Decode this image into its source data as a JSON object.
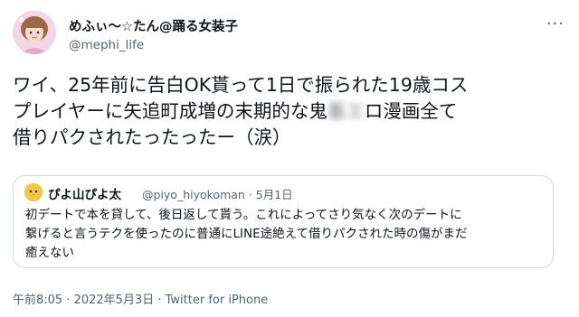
{
  "author": {
    "display_name": "めふぃ〜☆たん@踊る女装子",
    "handle": "@mephi_life"
  },
  "tweet": {
    "text_line1": "ワイ、25年前に告白OK貰って1日で振られた19歳コス",
    "text_line2": "プレイヤーに矢追町成増の末期的な鬼畜エロ漫画全て",
    "text_line3": "借りパクされたったったー（涙）",
    "blurred_segment": "畜エ"
  },
  "quote": {
    "name": "ぴよ山ぴよ太",
    "meta": "@piyo_hiyokoman · 5月1日",
    "text": "初デートで本を貸して、後日返して貰う。これによってさり気なく次のデートに\n繋げると言うテクを使ったのに普通にLINE途絶えて借りパクされた時の傷がまだ\n癒えない"
  },
  "footer": {
    "timestamp": "午前8:05 · 2022年5月3日",
    "source": "Twitter for iPhone"
  },
  "colors": {
    "text": "#0f1419",
    "secondary": "#536471",
    "border": "#cfd9de",
    "quote_avatar": "#f2c744"
  },
  "icons": {
    "more": "more-dots-icon",
    "quote_avatar": "chick-icon"
  }
}
